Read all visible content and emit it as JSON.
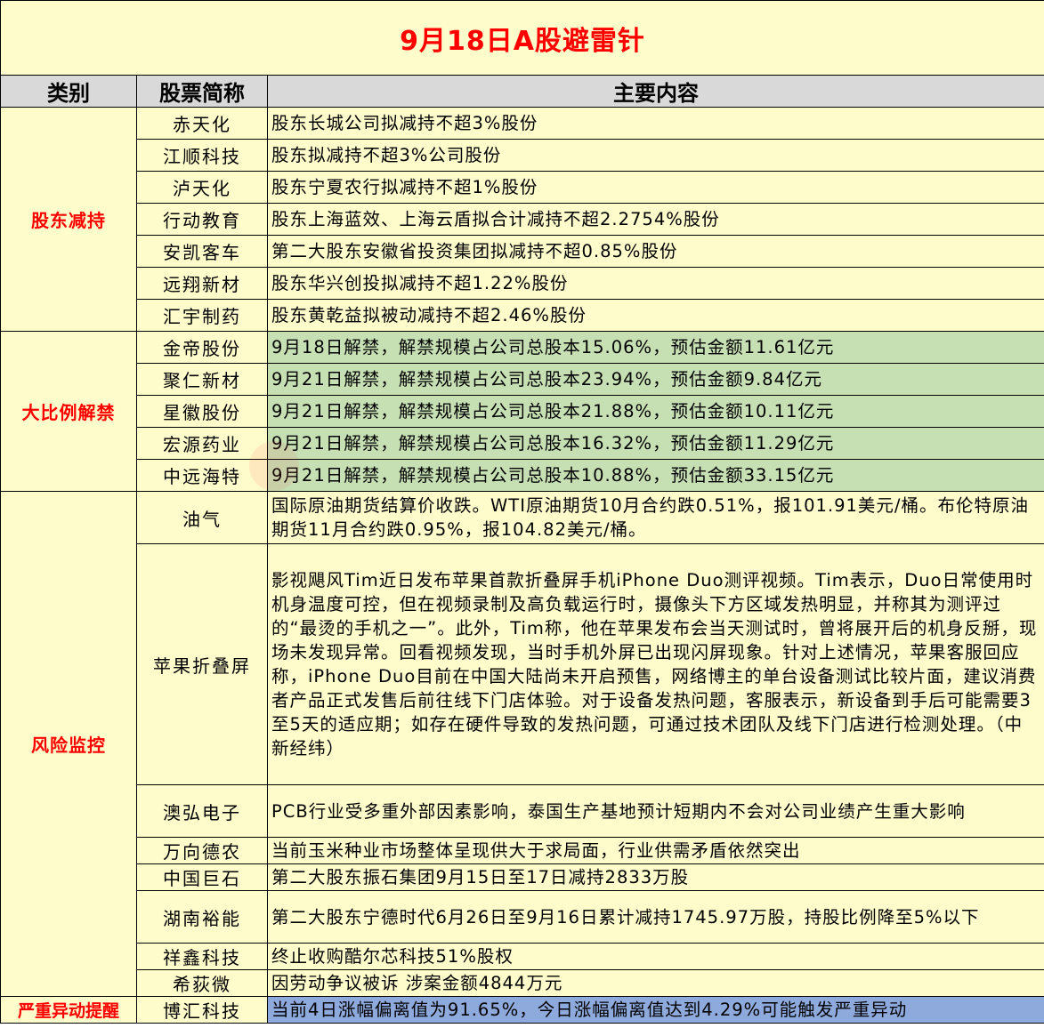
{
  "title": "9月18日A股避雷针",
  "headers": [
    "类别",
    "股票简称",
    "主要内容"
  ],
  "categories": {
    "reduce": "股东减持",
    "unlock": "大比例解禁",
    "risk": "风险监控",
    "abnormal": "严重异动提醒"
  },
  "colors": {
    "yellow": "#fffccc",
    "green": "#c6e0b4",
    "blue": "#8ea9db",
    "header": "#d9d9d9",
    "red": "#ff0000"
  },
  "rows": {
    "reduce": [
      {
        "name": "赤天化",
        "content": "股东长城公司拟减持不超3%股份"
      },
      {
        "name": "江顺科技",
        "content": "股东拟减持不超3%公司股份"
      },
      {
        "name": "泸天化",
        "content": "股东宁夏农行拟减持不超1%股份"
      },
      {
        "name": "行动教育",
        "content": "股东上海蓝效、上海云盾拟合计减持不超2.2754%股份"
      },
      {
        "name": "安凯客车",
        "content": "第二大股东安徽省投资集团拟减持不超0.85%股份"
      },
      {
        "name": "远翔新材",
        "content": "股东华兴创投拟减持不超1.22%股份"
      },
      {
        "name": "汇宇制药",
        "content": "股东黄乾益拟被动减持不超2.46%股份"
      }
    ],
    "unlock": [
      {
        "name": "金帝股份",
        "content": "9月18日解禁，解禁规模占公司总股本15.06%，预估金额11.61亿元"
      },
      {
        "name": "聚仁新材",
        "content": "9月21日解禁，解禁规模占公司总股本23.94%，预估金额9.84亿元"
      },
      {
        "name": "星徽股份",
        "content": "9月21日解禁，解禁规模占公司总股本21.88%，预估金额10.11亿元"
      },
      {
        "name": "宏源药业",
        "content": "9月21日解禁，解禁规模占公司总股本16.32%，预估金额11.29亿元"
      },
      {
        "name": "中远海特",
        "content": "9月21日解禁，解禁规模占公司总股本10.88%，预估金额33.15亿元"
      }
    ],
    "risk": [
      {
        "name": "油气",
        "content": "国际原油期货结算价收跌。WTI原油期货10月合约跌0.51%，报101.91美元/桶。布伦特原油期货11月合约跌0.95%，报104.82美元/桶。"
      },
      {
        "name": "苹果折叠屏",
        "content": "影视飓风Tim近日发布苹果首款折叠屏手机iPhone Duo测评视频。Tim表示，Duo日常使用时机身温度可控，但在视频录制及高负载运行时，摄像头下方区域发热明显，并称其为测评过的“最烫的手机之一”。此外，Tim称，他在苹果发布会当天测试时，曾将展开后的机身反掰，现场未发现异常。回看视频发现，当时手机外屏已出现闪屏现象。针对上述情况，苹果客服回应称，iPhone Duo目前在中国大陆尚未开启预售，网络博主的单台设备测试比较片面，建议消费者产品正式发售后前往线下门店体验。对于设备发热问题，客服表示，新设备到手后可能需要3至5天的适应期；如存在硬件导致的发热问题，可通过技术团队及线下门店进行检测处理。（中新经纬）"
      },
      {
        "name": "澳弘电子",
        "content": "PCB行业受多重外部因素影响，泰国生产基地预计短期内不会对公司业绩产生重大影响"
      },
      {
        "name": "万向德农",
        "content": "当前玉米种业市场整体呈现供大于求局面，行业供需矛盾依然突出"
      },
      {
        "name": "中国巨石",
        "content": "第二大股东振石集团9月15日至17日减持2833万股"
      },
      {
        "name": "湖南裕能",
        "content": "第二大股东宁德时代6月26日至9月16日累计减持1745.97万股，持股比例降至5%以下"
      },
      {
        "name": "祥鑫科技",
        "content": "终止收购酷尔芯科技51%股权"
      },
      {
        "name": "希荻微",
        "content": "因劳动争议被诉 涉案金额4844万元"
      }
    ],
    "abnormal": [
      {
        "name": "博汇科技",
        "content": "当前4日涨幅偏离值为91.65%，今日涨幅偏离值达到4.29%可能触发严重异动"
      }
    ]
  }
}
